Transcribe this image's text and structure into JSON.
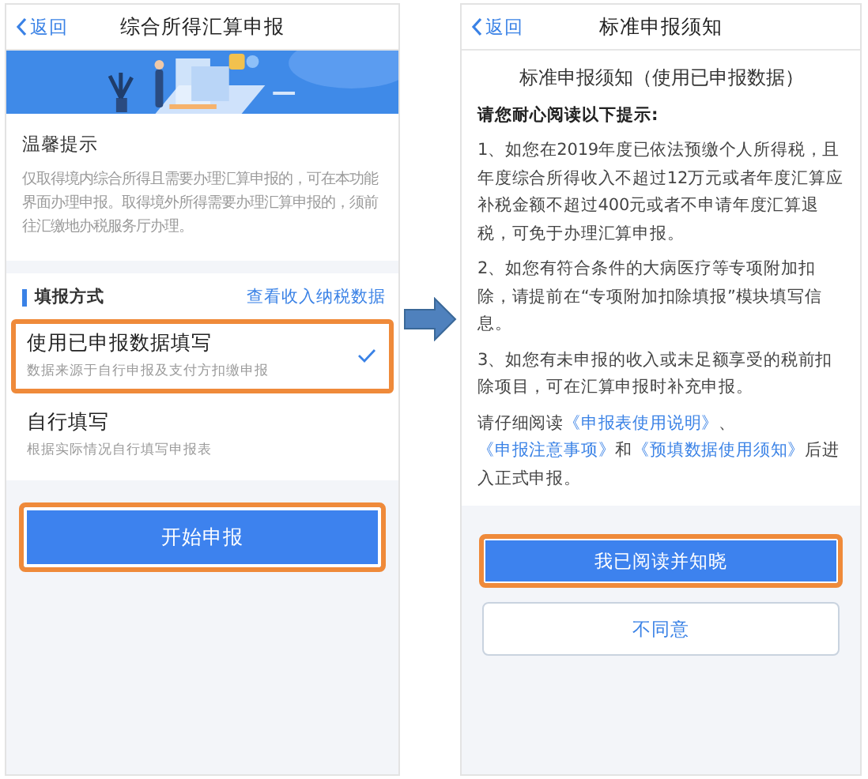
{
  "left_screen": {
    "nav": {
      "back": "返回",
      "title": "综合所得汇算申报"
    },
    "tips": {
      "title": "温馨提示",
      "text": "仅取得境内综合所得且需要办理汇算申报的，可在本功能界面办理申报。取得境外所得需要办理汇算申报的，须前往汇缴地办税服务厅办理。"
    },
    "method": {
      "title": "填报方式",
      "link": "查看收入纳税数据",
      "options": [
        {
          "label": "使用已申报数据填写",
          "description": "数据来源于自行申报及支付方扣缴申报",
          "selected": true,
          "highlighted": true
        },
        {
          "label": "自行填写",
          "description": "根据实际情况自行填写申报表",
          "selected": false,
          "highlighted": false
        }
      ]
    },
    "button": {
      "label": "开始申报",
      "highlighted": true
    }
  },
  "right_screen": {
    "nav": {
      "back": "返回",
      "title": "标准申报须知"
    },
    "heading": "标准申报须知（使用已申报数据）",
    "intro": "请您耐心阅读以下提示:",
    "items": [
      "1、如您在2019年度已依法预缴个人所得税，且年度综合所得收入不超过12万元或者年度汇算应补税金额不超过400元或者不申请年度汇算退税，可免于办理汇算申报。",
      "2、如您有符合条件的大病医疗等专项附加扣除，请提前在“专项附加扣除填报”模块填写信息。",
      "3、如您有未申报的收入或未足额享受的税前扣除项目，可在汇算申报时补充申报。"
    ],
    "closing": [
      {
        "text": "请仔细阅读",
        "kind": "plain"
      },
      {
        "text": "《申报表使用说明》",
        "kind": "link"
      },
      {
        "text": "、",
        "kind": "plain"
      },
      {
        "text": "《申报注意事项》",
        "kind": "link"
      },
      {
        "text": "和",
        "kind": "plain"
      },
      {
        "text": "《预填数据使用须知》",
        "kind": "link"
      },
      {
        "text": "后进入正式申报。",
        "kind": "plain"
      }
    ],
    "buttons": [
      {
        "label": "我已阅读并知晓",
        "kind": "primary",
        "highlighted": true
      },
      {
        "label": "不同意",
        "kind": "secondary",
        "highlighted": false
      }
    ]
  }
}
